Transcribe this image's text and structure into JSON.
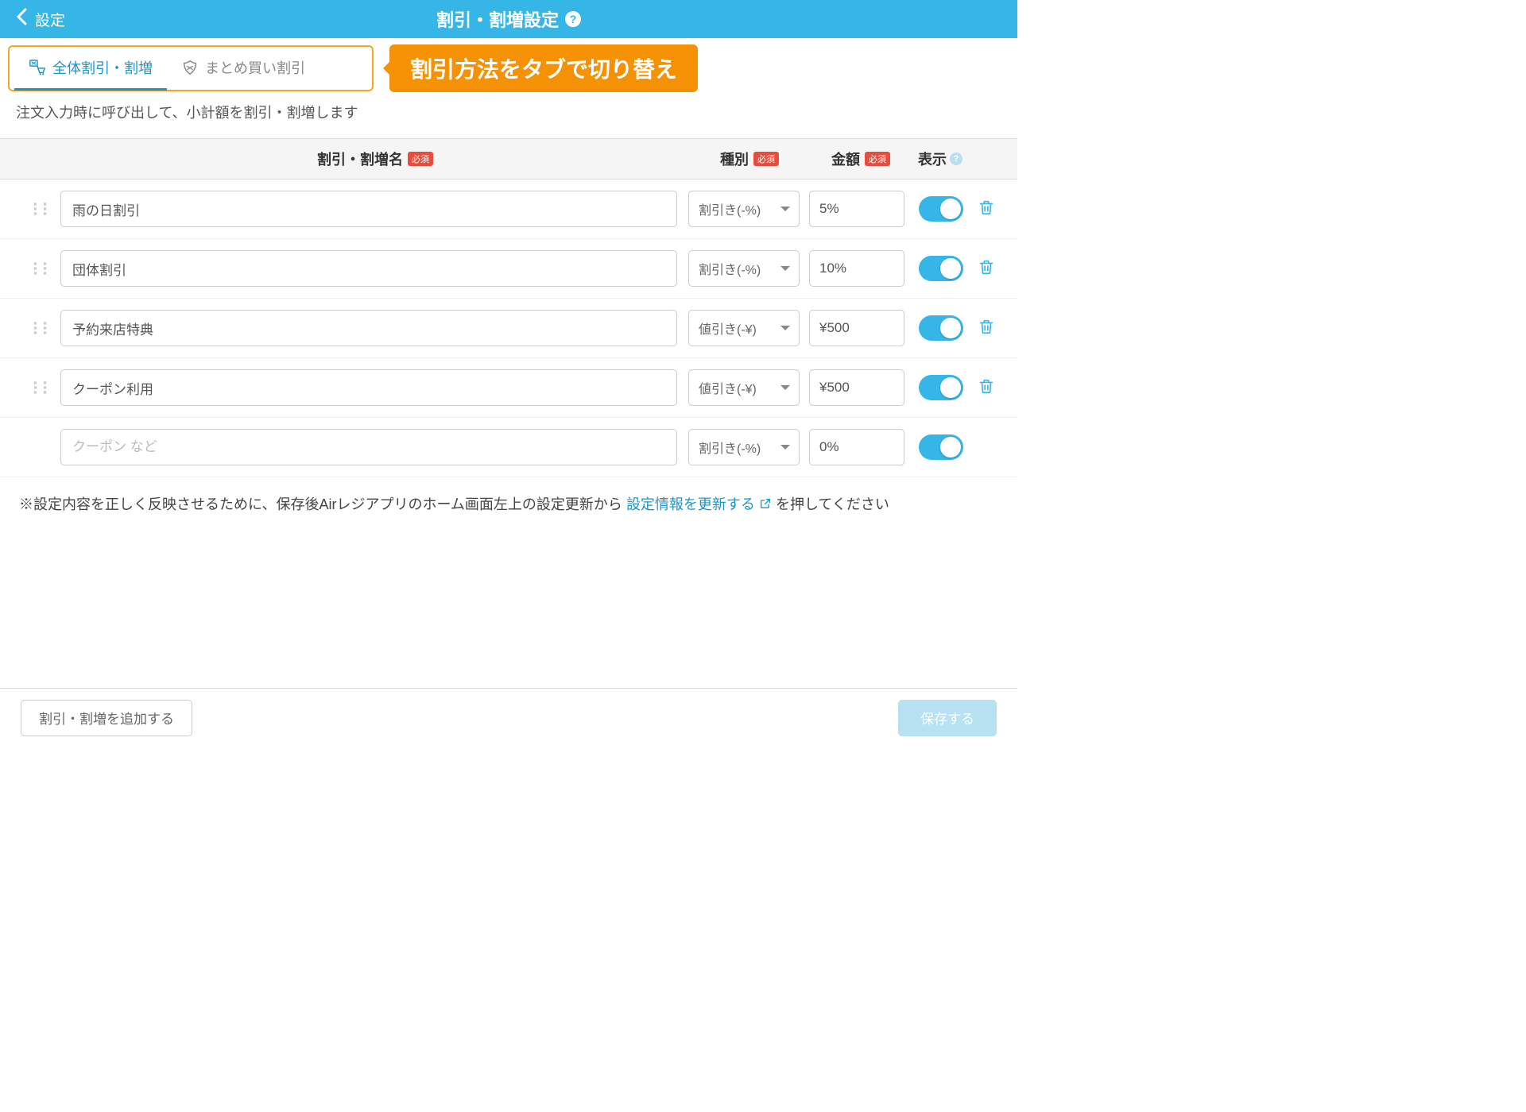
{
  "header": {
    "back_label": "設定",
    "title": "割引・割増設定"
  },
  "tabs": {
    "overall": "全体割引・割増",
    "bulk": "まとめ買い割引"
  },
  "callout": "割引方法をタブで切り替え",
  "description": "注文入力時に呼び出して、小計額を割引・割増します",
  "columns": {
    "name": "割引・割増名",
    "type": "種別",
    "amount": "金額",
    "show": "表示",
    "required": "必須"
  },
  "rows": [
    {
      "name": "雨の日割引",
      "type": "割引き(-%)",
      "amount": "5%",
      "toggle": true,
      "deletable": true,
      "placeholder": ""
    },
    {
      "name": "団体割引",
      "type": "割引き(-%)",
      "amount": "10%",
      "toggle": true,
      "deletable": true,
      "placeholder": ""
    },
    {
      "name": "予約来店特典",
      "type": "値引き(-¥)",
      "amount": "¥500",
      "toggle": true,
      "deletable": true,
      "placeholder": ""
    },
    {
      "name": "クーポン利用",
      "type": "値引き(-¥)",
      "amount": "¥500",
      "toggle": true,
      "deletable": true,
      "placeholder": ""
    },
    {
      "name": "",
      "type": "割引き(-%)",
      "amount": "0%",
      "toggle": true,
      "deletable": false,
      "placeholder": "クーポン など"
    }
  ],
  "footer_note": {
    "prefix": "※設定内容を正しく反映させるために、保存後Airレジアプリのホーム画面左上の設定更新から",
    "link": "設定情報を更新する",
    "suffix": "を押してください"
  },
  "buttons": {
    "add": "割引・割増を追加する",
    "save": "保存する"
  }
}
